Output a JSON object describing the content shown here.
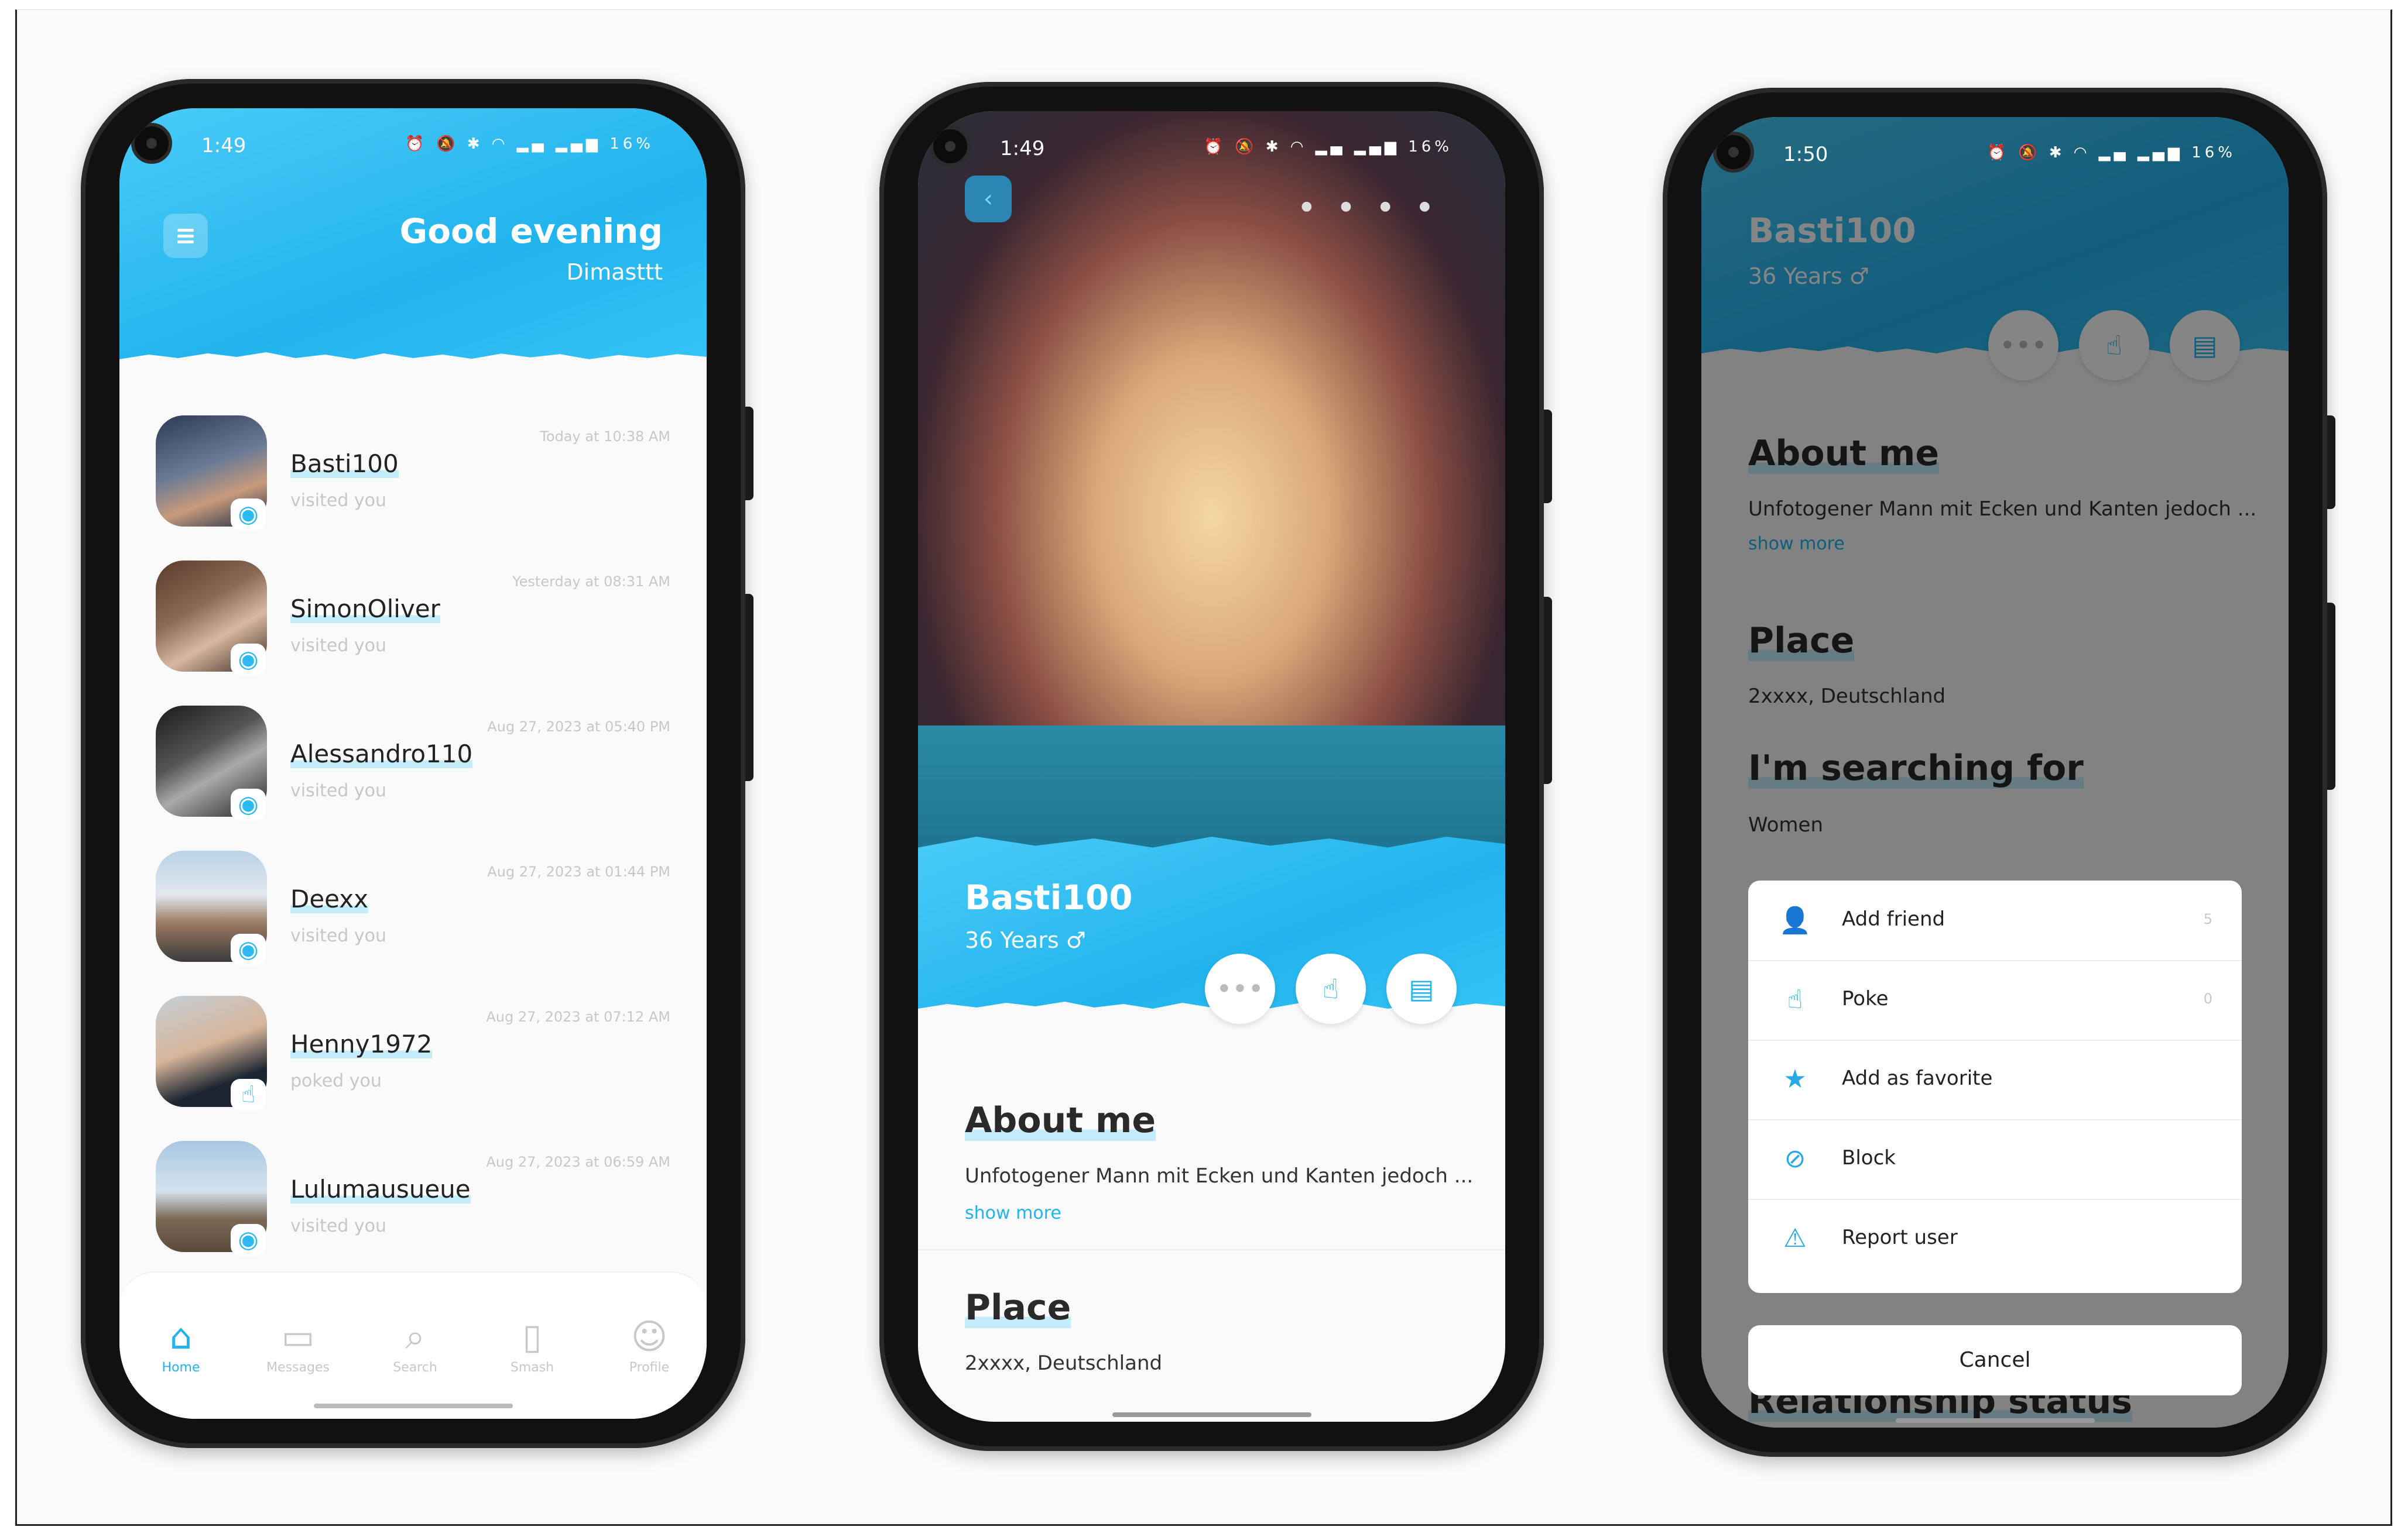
{
  "colors": {
    "accent": "#22b4ee",
    "header": "#49cbf7",
    "subtle": "#c7c7c7"
  },
  "screen1": {
    "status_time": "1:49",
    "status_battery": "16%",
    "greeting": "Good evening",
    "user_name": "Dimasttt",
    "visitors": [
      {
        "name": "Basti100",
        "action": "visited you",
        "time": "Today at 10:38 AM",
        "icon": "eye-icon"
      },
      {
        "name": "SimonOliver",
        "action": "visited you",
        "time": "Yesterday at 08:31 AM",
        "icon": "eye-icon"
      },
      {
        "name": "Alessandro110",
        "action": "visited you",
        "time": "Aug 27, 2023 at 05:40 PM",
        "icon": "eye-icon"
      },
      {
        "name": "Deexx",
        "action": "visited you",
        "time": "Aug 27, 2023 at 01:44 PM",
        "icon": "eye-icon"
      },
      {
        "name": "Henny1972",
        "action": "poked you",
        "time": "Aug 27, 2023 at 07:12 AM",
        "icon": "poke-icon"
      },
      {
        "name": "Lulumausueue",
        "action": "visited you",
        "time": "Aug 27, 2023 at 06:59 AM",
        "icon": "eye-icon"
      }
    ],
    "nav": [
      {
        "label": "Home",
        "icon": "home-icon",
        "active": true
      },
      {
        "label": "Messages",
        "icon": "messages-icon"
      },
      {
        "label": "Search",
        "icon": "search-icon"
      },
      {
        "label": "Smash",
        "icon": "smash-icon"
      },
      {
        "label": "Profile",
        "icon": "profile-icon"
      }
    ]
  },
  "screen2": {
    "status_time": "1:49",
    "status_battery": "16%",
    "profile_name": "Basti100",
    "profile_age": "36 Years",
    "about_title": "About me",
    "about_text": "Unfotogener Mann mit Ecken und Kanten jedoch ...",
    "show_more": "show more",
    "place_title": "Place",
    "place_text": "2xxxx, Deutschland"
  },
  "screen3": {
    "status_time": "1:50",
    "status_battery": "16%",
    "profile_name": "Basti100",
    "profile_age": "36 Years",
    "about_title": "About me",
    "about_text": "Unfotogener Mann mit Ecken und Kanten jedoch ...",
    "show_more": "show more",
    "place_title": "Place",
    "place_text": "2xxxx, Deutschland",
    "searching_title": "I'm searching for",
    "searching_text": "Women",
    "relationship_title": "Relationship status",
    "sheet": [
      {
        "label": "Add friend",
        "icon": "add-friend-icon",
        "count": "5"
      },
      {
        "label": "Poke",
        "icon": "poke-icon",
        "count": "0"
      },
      {
        "label": "Add as favorite",
        "icon": "star-icon",
        "count": ""
      },
      {
        "label": "Block",
        "icon": "block-icon",
        "count": ""
      },
      {
        "label": "Report user",
        "icon": "warning-icon",
        "count": ""
      }
    ],
    "cancel": "Cancel"
  }
}
